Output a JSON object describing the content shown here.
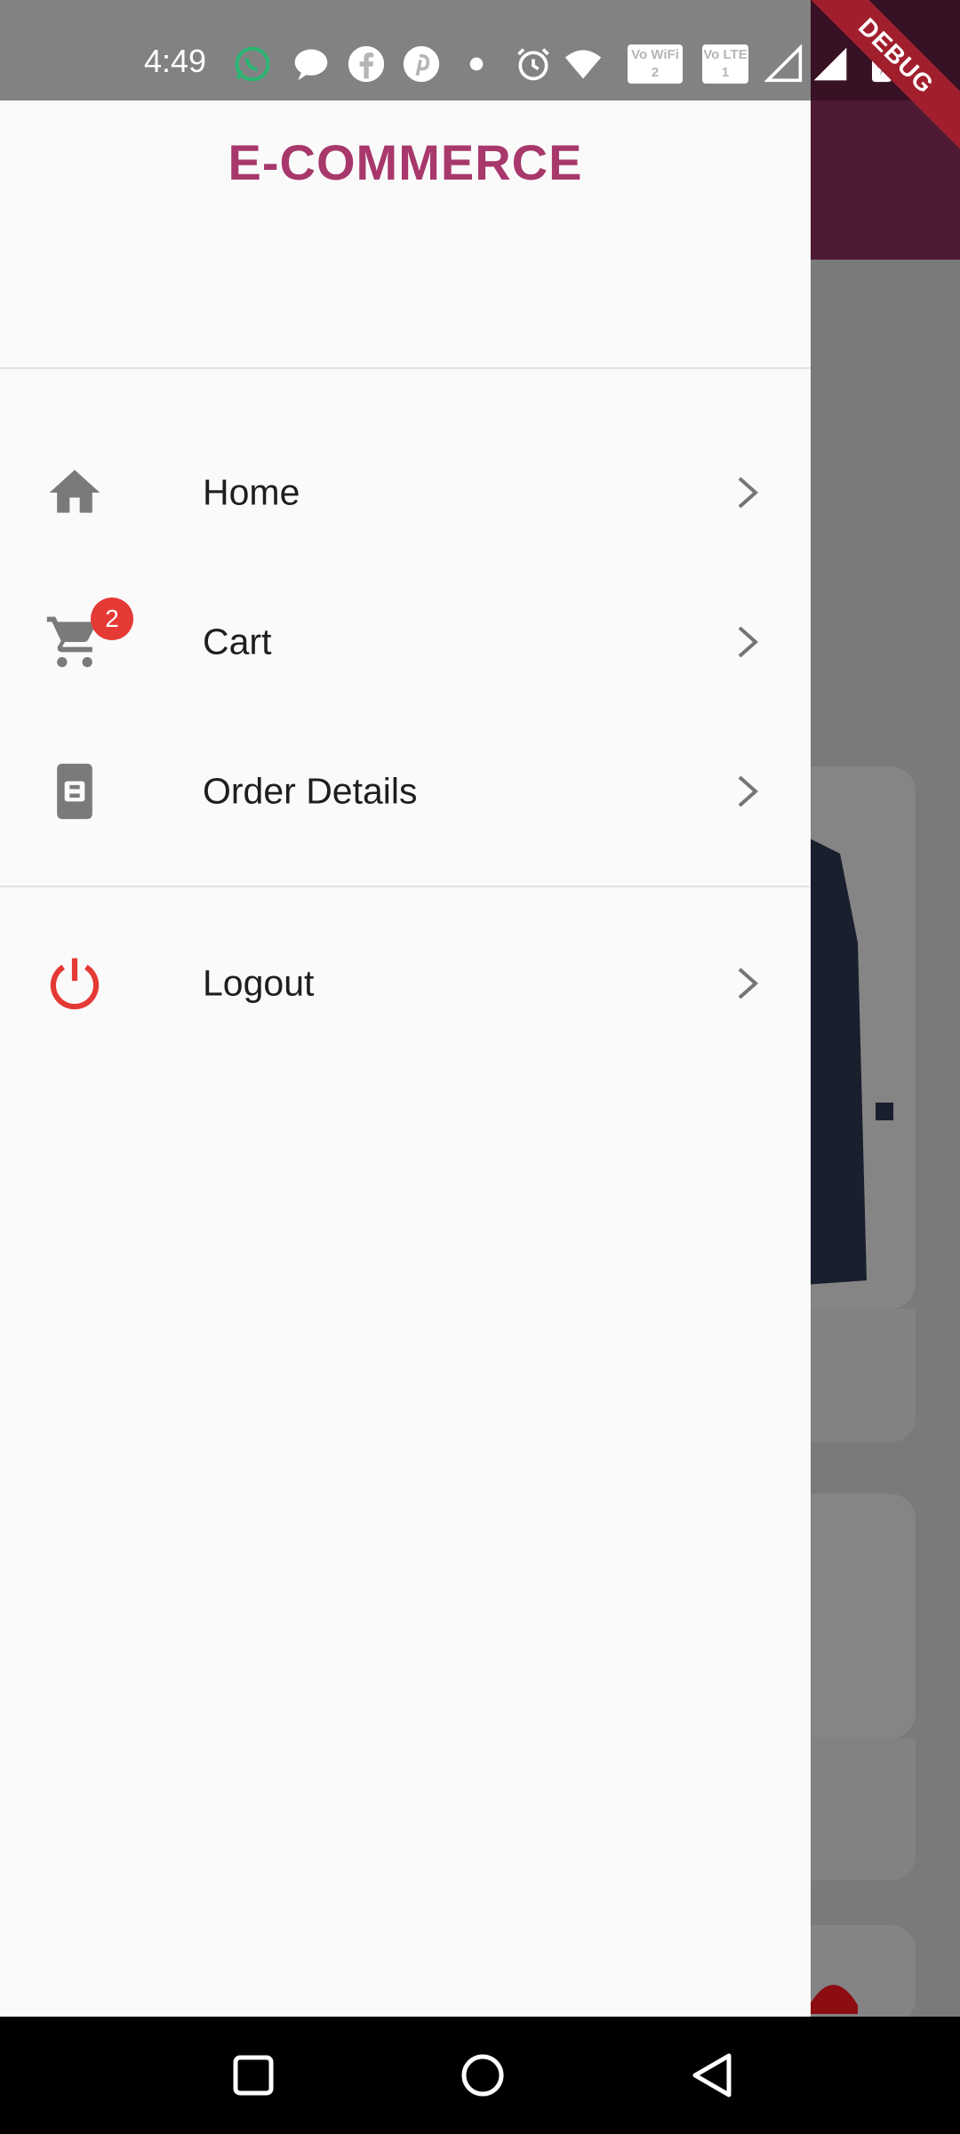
{
  "status_bar": {
    "time": "4:49",
    "icons": [
      "whatsapp-icon",
      "message-icon",
      "facebook-icon",
      "pinterest-icon",
      "dot-icon",
      "alarm-icon",
      "wifi-icon",
      "vowifi-icon",
      "volte-icon",
      "signal-icon",
      "signal-icon",
      "battery-charging-icon"
    ],
    "vowifi_text": "Vo WiFi 2",
    "volte_text": "Vo LTE 1"
  },
  "debug_banner": "DEBUG",
  "drawer": {
    "title": "E-COMMERCE",
    "title_color": "#a8386c",
    "items": [
      {
        "label": "Home",
        "icon": "home-icon"
      },
      {
        "label": "Cart",
        "icon": "cart-icon",
        "badge": "2"
      },
      {
        "label": "Order Details",
        "icon": "order-details-icon"
      }
    ],
    "logout": {
      "label": "Logout",
      "icon": "power-icon",
      "icon_color": "#e53935"
    }
  },
  "nav_bar": {
    "buttons": [
      "recents-button",
      "home-button",
      "back-button"
    ]
  }
}
